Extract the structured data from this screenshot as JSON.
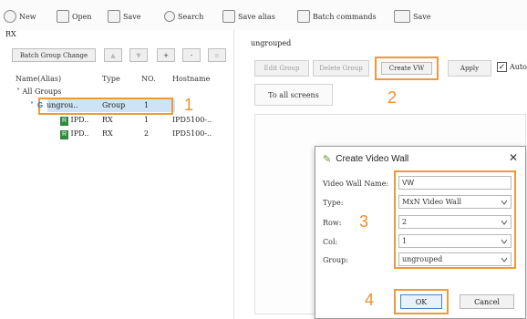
{
  "toolbar": {
    "new_label": "New",
    "open_label": "Open",
    "save_label": "Save",
    "search_label": "Search",
    "save_alias_label": "Save alias",
    "batch_commands_label": "Batch commands",
    "save2_label": "Save"
  },
  "left": {
    "title": "RX",
    "batch_group_change_label": "Batch Group Change",
    "add_label": "+",
    "remove_label": "-",
    "columns": [
      "Name(Alias)",
      "Type",
      "NO.",
      "Hostname"
    ],
    "tree": {
      "root": "All Groups",
      "group": {
        "name": "ungrou..",
        "type": "Group",
        "no": "1"
      },
      "children": [
        {
          "badge": "R",
          "name": "IPD..",
          "type": "RX",
          "no": "1",
          "hostname": "IPD5100-.."
        },
        {
          "badge": "R",
          "name": "IPD..",
          "type": "RX",
          "no": "2",
          "hostname": "IPD5100-.."
        }
      ]
    }
  },
  "right": {
    "section_title": "ungrouped",
    "edit_group_label": "Edit Group",
    "delete_group_label": "Delete Group",
    "create_vw_label": "Create VW",
    "apply_label": "Apply",
    "auto_label": "Auto",
    "to_all_screens_label": "To all screens"
  },
  "dialog": {
    "title": "Create Video Wall",
    "close_label": "✕",
    "fields": {
      "name_label": "Video Wall Name:",
      "name_value": "VW",
      "type_label": "Type:",
      "type_value": "MxN Video Wall",
      "row_label": "Row:",
      "row_value": "2",
      "col_label": "Col:",
      "col_value": "1",
      "group_label": "Group:",
      "group_value": "ungrouped"
    },
    "ok_label": "OK",
    "cancel_label": "Cancel"
  },
  "steps": {
    "s1": "1",
    "s2": "2",
    "s3": "3",
    "s4": "4"
  },
  "colors": {
    "highlight": "#ee9a3a",
    "rx_badge": "#2e8b3d",
    "group_icon": "#2b6fd6",
    "selection": "#cfe3f7"
  }
}
